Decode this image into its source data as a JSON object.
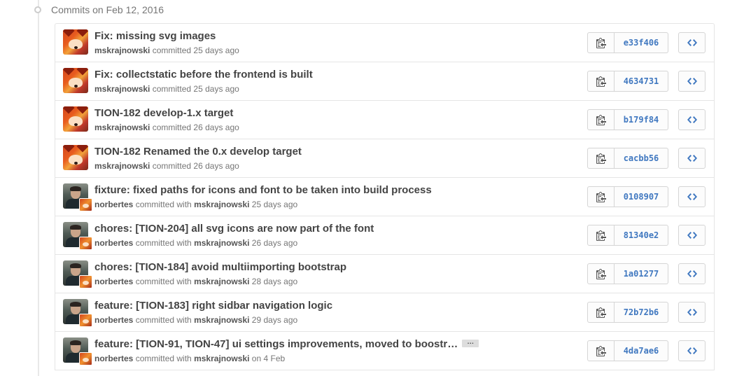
{
  "day_header": "Commits on Feb 12, 2016",
  "colors": {
    "sha_link": "#4078c0",
    "border": "#e5e5e5",
    "muted": "#767676"
  },
  "icons": {
    "copy": "clipboard-icon",
    "browse": "code-icon"
  },
  "commits": [
    {
      "title": "Fix: missing svg images",
      "author": "mskrajnowski",
      "committer": "",
      "action": "committed",
      "when": "25 days ago",
      "sha": "e33f406",
      "avatar": "fox"
    },
    {
      "title": "Fix: collectstatic before the frontend is built",
      "author": "mskrajnowski",
      "committer": "",
      "action": "committed",
      "when": "25 days ago",
      "sha": "4634731",
      "avatar": "fox"
    },
    {
      "title": "TION-182 develop-1.x target",
      "author": "mskrajnowski",
      "committer": "",
      "action": "committed",
      "when": "26 days ago",
      "sha": "b179f84",
      "avatar": "fox"
    },
    {
      "title": "TION-182 Renamed the 0.x develop target",
      "author": "mskrajnowski",
      "committer": "",
      "action": "committed",
      "when": "26 days ago",
      "sha": "cacbb56",
      "avatar": "fox"
    },
    {
      "title": "fixture: fixed paths for icons and font to be taken into build process",
      "author": "norbertes",
      "committer": "mskrajnowski",
      "action": "committed with",
      "when": "25 days ago",
      "sha": "0108907",
      "avatar": "person"
    },
    {
      "title": "chores: [TION-204] all svg icons are now part of the font",
      "author": "norbertes",
      "committer": "mskrajnowski",
      "action": "committed with",
      "when": "26 days ago",
      "sha": "81340e2",
      "avatar": "person"
    },
    {
      "title": "chores: [TION-184] avoid multiimporting bootstrap",
      "author": "norbertes",
      "committer": "mskrajnowski",
      "action": "committed with",
      "when": "28 days ago",
      "sha": "1a01277",
      "avatar": "person"
    },
    {
      "title": "feature: [TION-183] right sidbar navigation logic",
      "author": "norbertes",
      "committer": "mskrajnowski",
      "action": "committed with",
      "when": "29 days ago",
      "sha": "72b72b6",
      "avatar": "person"
    },
    {
      "title": "feature: [TION-91, TION-47] ui settings improvements, moved to boostr…",
      "author": "norbertes",
      "committer": "mskrajnowski",
      "action": "committed with",
      "when": "on 4 Feb",
      "sha": "4da7ae6",
      "avatar": "person",
      "has_ellipsis": true,
      "ellipsis_label": "…"
    }
  ]
}
